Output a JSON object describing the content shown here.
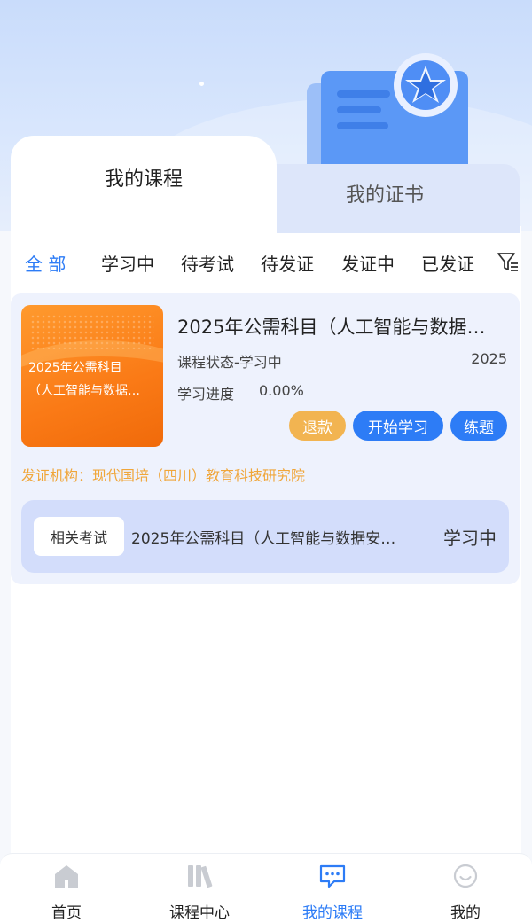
{
  "tabs": {
    "my_courses": "我的课程",
    "my_certificates": "我的证书"
  },
  "filters": {
    "all": "全 部",
    "studying": "学习中",
    "pending_exam": "待考试",
    "pending_cert": "待发证",
    "issuing": "发证中",
    "issued": "已发证"
  },
  "course": {
    "thumb_line1": "2025年公需科目",
    "thumb_line2": "（人工智能与数据…",
    "title": "2025年公需科目（人工智能与数据…",
    "status": "课程状态-学习中",
    "year": "2025",
    "progress_label": "学习进度",
    "progress_value": "0.00%",
    "btn_refund": "退款",
    "btn_start": "开始学习",
    "btn_practice": "练题",
    "issuer": "发证机构：现代国培（四川）教育科技研究院",
    "exam_tag": "相关考试",
    "exam_name": "2025年公需科目（人工智能与数据安…",
    "exam_status": "学习中"
  },
  "nav": {
    "home": "首页",
    "course_center": "课程中心",
    "my_courses": "我的课程",
    "mine": "我的"
  },
  "colors": {
    "accent": "#2d7cf6",
    "refund": "#f2b451",
    "issuer": "#f0a63a",
    "thumb": "#fa7a16"
  },
  "icons": [
    "filter-icon",
    "home-icon",
    "books-icon",
    "chat-icon",
    "smile-icon",
    "certificate-illustration"
  ]
}
